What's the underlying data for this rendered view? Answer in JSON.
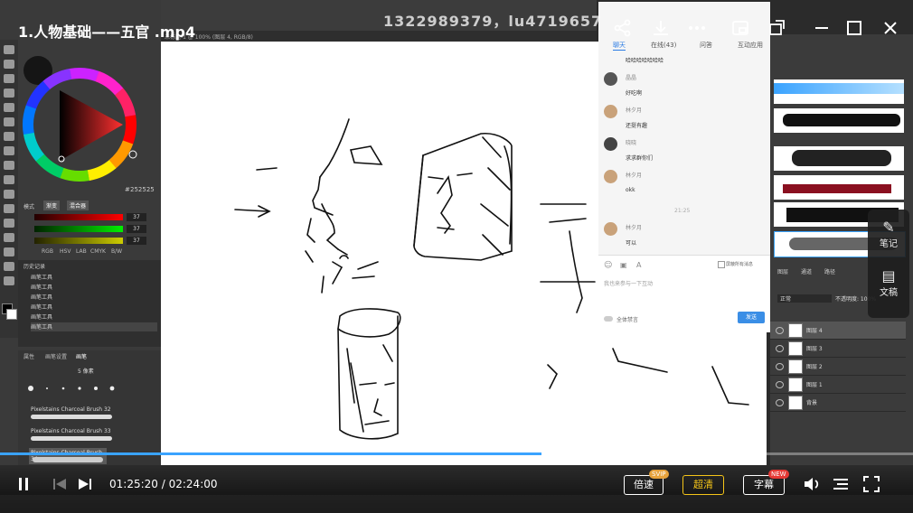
{
  "video": {
    "title": "1.人物基础——五官 .mp4",
    "watermark": "1322989379，lu4719657",
    "current_time": "01:25:20",
    "separator": "/",
    "total_time": "02:24:00",
    "progress": 0.593,
    "speed_label": "倍速",
    "speed_badge": "SVIP",
    "quality_label": "超清",
    "subtitle_label": "字幕",
    "subtitle_badge": "NEW"
  },
  "side_float": {
    "notes_label": "笔记",
    "doc_label": "文稿"
  },
  "csp": {
    "doc_tab": "未标题-1 @ 100% (图层 4, RGB/8)",
    "color_value": "252525",
    "color_tabs": [
      "模式",
      "渐变",
      "混合器"
    ],
    "rgb_values": [
      "37",
      "37",
      "37"
    ],
    "model_tabs": [
      "RGB",
      "HSV",
      "LAB",
      "CMYK",
      "B/W"
    ],
    "history_title": "历史记录",
    "history_items": [
      "画笔工具",
      "画笔工具",
      "画笔工具",
      "画笔工具",
      "画笔工具",
      "画笔工具"
    ],
    "brush_tabs": [
      "属性",
      "画笔设置",
      "画笔"
    ],
    "brush_size": "5 像素",
    "brush_names": [
      "Pixelstains Charcoal Brush 32",
      "Pixelstains Charcoal Brush 33",
      "Pixelstains Charcoal Brush 34"
    ]
  },
  "chat": {
    "tabs": [
      "聊天",
      "在线(43)",
      "问答",
      "互动应用"
    ],
    "messages": [
      {
        "name": "",
        "text": "哈哈哈哈哈哈哈"
      },
      {
        "name": "晶晶",
        "text": "好吃啊"
      },
      {
        "name": "林夕月",
        "text": "还挺有趣"
      },
      {
        "name": "晓晓",
        "text": "求求群你们"
      },
      {
        "name": "林夕月",
        "text": "okk"
      },
      {
        "name": "林夕月",
        "text": "可以"
      }
    ],
    "timestamp": "21:25",
    "input_placeholder": "我也来参与一下互动",
    "checkbox_label": "屏蔽所有消息",
    "toggle_label": "全体禁言",
    "send_label": "发送"
  },
  "ps": {
    "panel_tabs": [
      "图层",
      "通道",
      "路径"
    ],
    "blend_mode": "正常",
    "opacity_label": "不透明度: 100%",
    "layers": [
      "图层 4",
      "图层 3",
      "图层 2",
      "图层 1",
      "背景"
    ]
  },
  "colors": {
    "accent": "#3aa3ff",
    "chat_send": "#3a8ee6",
    "quality": "#f5c518",
    "badge_new": "#e53935",
    "badge_svip": "#e6a23c"
  }
}
